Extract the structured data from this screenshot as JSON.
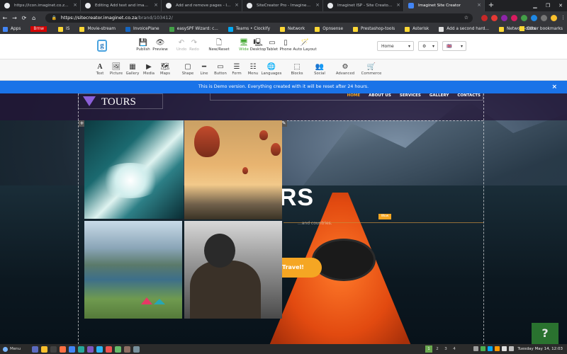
{
  "browser": {
    "tabs": [
      {
        "title": "https://icon.imaginet.co.za/c..."
      },
      {
        "title": "Editing Add text and image - I..."
      },
      {
        "title": "Add and remove pages - Imagin..."
      },
      {
        "title": "SiteCreator Pro - Imaginet FAQ"
      },
      {
        "title": "Imaginet ISP - Site Creator Ho..."
      },
      {
        "title": "Imaginet Site Creator"
      }
    ],
    "new_tab": "+",
    "url_host": "https://sitecreator.imaginet.co.za",
    "url_path": "/brand/103412/",
    "bookmarks": [
      "Apps",
      "Brnw",
      "IS",
      "Movie-stream",
      "InvoicePlane",
      "easySPF Wizard: c...",
      "Teams • Clockify",
      "Network",
      "Opnsense",
      "Prestashop-tools",
      "Asterisk",
      "Add a second hard...",
      "Network-disks"
    ],
    "other_bookmarks": "Other bookmarks"
  },
  "editor": {
    "logo_letter": "g",
    "toolbar": [
      {
        "label": "Publish",
        "glyph": "💾",
        "state": "normal"
      },
      {
        "label": "Preview",
        "glyph": "👁",
        "state": "normal"
      },
      {
        "label": "Undo",
        "glyph": "↶",
        "state": "disabled"
      },
      {
        "label": "Redo",
        "glyph": "↷",
        "state": "disabled"
      },
      {
        "label": "New/Reset",
        "glyph": "🗋",
        "state": "normal"
      },
      {
        "label": "Wide",
        "glyph": "🖥",
        "state": "green"
      },
      {
        "label": "Desktop",
        "glyph": "🖳",
        "state": "normal"
      },
      {
        "label": "Tablet",
        "glyph": "▭",
        "state": "normal"
      },
      {
        "label": "Phone",
        "glyph": "▯",
        "state": "normal"
      },
      {
        "label": "Auto Layout",
        "glyph": "🪄",
        "state": "normal"
      }
    ],
    "page_select": "Home",
    "settings_glyph": "⚙",
    "language_flag": "🇬🇧",
    "widgets": [
      {
        "label": "Text",
        "glyph": "A"
      },
      {
        "label": "Picture",
        "glyph": "🖼"
      },
      {
        "label": "Gallery",
        "glyph": "▦"
      },
      {
        "label": "Media",
        "glyph": "▶"
      },
      {
        "label": "Maps",
        "glyph": "🗺"
      },
      {
        "label": "Shape",
        "glyph": "▢"
      },
      {
        "label": "Line",
        "glyph": "━"
      },
      {
        "label": "Button",
        "glyph": "▭"
      },
      {
        "label": "Form",
        "glyph": "☰"
      },
      {
        "label": "Menu",
        "glyph": "☷"
      },
      {
        "label": "Languages",
        "glyph": "🌐"
      },
      {
        "label": "Blocks",
        "glyph": "⬚"
      },
      {
        "label": "Social",
        "glyph": "👥"
      },
      {
        "label": "Advanced",
        "glyph": "⚙"
      },
      {
        "label": "Commerce",
        "glyph": "🛒"
      }
    ],
    "banner_text": "This is Demo version. Everything created with it will be reset after 24 hours.",
    "banner_close": "×"
  },
  "site": {
    "logo_text": "TOURS",
    "menu": [
      {
        "label": "HOME",
        "active": true
      },
      {
        "label": "ABOUT US",
        "active": false
      },
      {
        "label": "SERVICES",
        "active": false
      },
      {
        "label": "GALLERY",
        "active": false
      },
      {
        "label": "CONTACTS",
        "active": false
      }
    ],
    "hero_title": "RE TOURS",
    "hero_sub": "...and countries.",
    "edit_badge": "Wow",
    "cta_label": "Travel!"
  },
  "help_label": "?",
  "taskbar": {
    "start_label": "Menu",
    "workspaces": [
      "1",
      "2",
      "3",
      "4"
    ],
    "clock": "Tuesday May 14, 12:03"
  }
}
